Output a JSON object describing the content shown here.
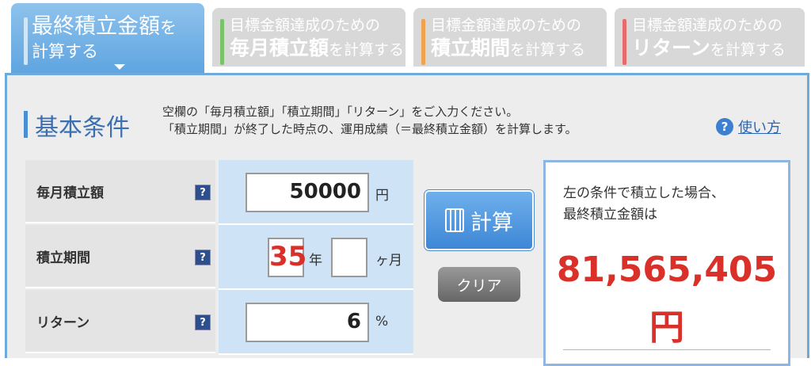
{
  "tabs": [
    {
      "line1": "最終積立金額",
      "line1_suffix": "を",
      "line2": "計算する",
      "accent": "#cfe6f8",
      "active": true
    },
    {
      "line1": "目標金額達成のための",
      "line2": "毎月積立額",
      "line2_suffix": "を計算する",
      "accent": "#7ac36a"
    },
    {
      "line1": "目標金額達成のための",
      "line2": "積立期間",
      "line2_suffix": "を計算する",
      "accent": "#f0a24e"
    },
    {
      "line1": "目標金額達成のための",
      "line2": "リターン",
      "line2_suffix": "を計算する",
      "accent": "#e86a6a"
    }
  ],
  "section": {
    "title": "基本条件",
    "desc1": "空欄の「毎月積立額」「積立期間」「リターン」をご入力ください。",
    "desc2": "「積立期間」が終了した時点の、運用成績（＝最終積立金額）を計算します。",
    "help_label": "使い方"
  },
  "form": {
    "monthly": {
      "label": "毎月積立額",
      "value": "50000",
      "unit": "円"
    },
    "period": {
      "label": "積立期間",
      "years": "35",
      "years_unit": "年",
      "months": "",
      "months_unit": "ヶ月"
    },
    "return": {
      "label": "リターン",
      "value": "6",
      "unit": "%"
    },
    "q": "?"
  },
  "buttons": {
    "calc": "計算",
    "clear": "クリア"
  },
  "result": {
    "line1": "左の条件で積立した場合、",
    "line2": "最終積立金額は",
    "amount": "81,565,405",
    "unit": "円"
  },
  "colors": {
    "accent_blue": "#4a8fd3",
    "result_red": "#d9302a"
  }
}
